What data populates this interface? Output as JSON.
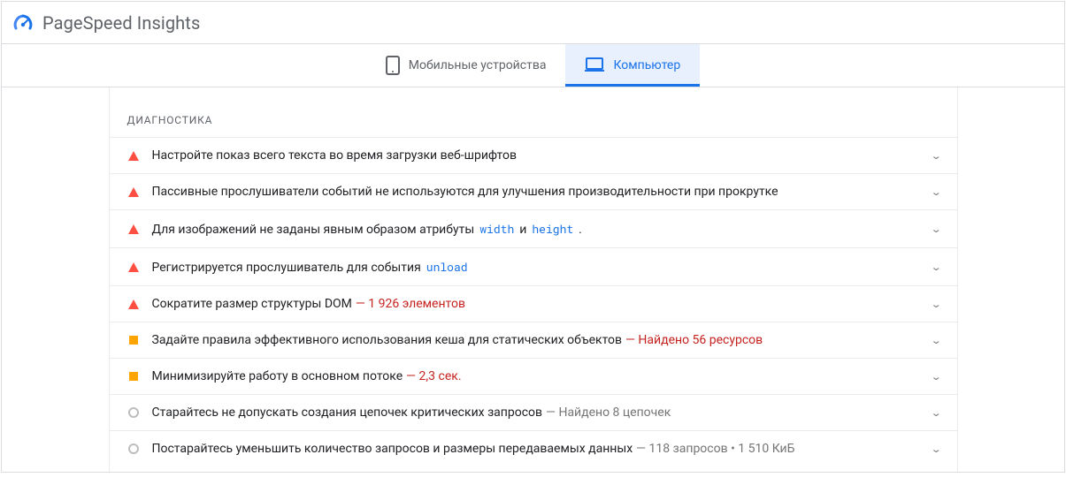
{
  "header": {
    "title": "PageSpeed Insights"
  },
  "tabs": {
    "mobile": {
      "label": "Мобильные устройства"
    },
    "desktop": {
      "label": "Компьютер"
    }
  },
  "section": {
    "title": "ДИАГНОСТИКА"
  },
  "audits": [
    {
      "severity": "fail",
      "parts": [
        {
          "t": "Настройте показ всего текста во время загрузки веб-шрифтов"
        }
      ]
    },
    {
      "severity": "fail",
      "parts": [
        {
          "t": "Пассивные прослушиватели событий не используются для улучшения производительности при прокрутке"
        }
      ]
    },
    {
      "severity": "fail",
      "parts": [
        {
          "t": "Для изображений не заданы явным образом атрибуты "
        },
        {
          "t": "width",
          "style": "code"
        },
        {
          "t": " и "
        },
        {
          "t": "height",
          "style": "code"
        },
        {
          "t": "."
        }
      ]
    },
    {
      "severity": "fail",
      "parts": [
        {
          "t": "Регистрируется прослушиватель для события "
        },
        {
          "t": "unload",
          "style": "code"
        }
      ]
    },
    {
      "severity": "fail",
      "parts": [
        {
          "t": "Сократите размер структуры DOM "
        },
        {
          "t": " — 1 926 элементов",
          "style": "metric-red"
        }
      ]
    },
    {
      "severity": "warn",
      "parts": [
        {
          "t": "Задайте правила эффективного использования кеша для статических объектов "
        },
        {
          "t": " — Найдено 56 ресурсов",
          "style": "metric-red"
        }
      ]
    },
    {
      "severity": "warn",
      "parts": [
        {
          "t": "Минимизируйте работу в основном потоке "
        },
        {
          "t": " — 2,3 сек.",
          "style": "metric-red"
        }
      ]
    },
    {
      "severity": "info",
      "parts": [
        {
          "t": "Старайтесь не допускать создания цепочек критических запросов "
        },
        {
          "t": " — Найдено 8 цепочек",
          "style": "metric-gray"
        }
      ]
    },
    {
      "severity": "info",
      "parts": [
        {
          "t": "Постарайтесь уменьшить количество запросов и размеры передаваемых данных "
        },
        {
          "t": " — 118 запросов • 1 510 КиБ",
          "style": "metric-gray"
        }
      ]
    }
  ]
}
